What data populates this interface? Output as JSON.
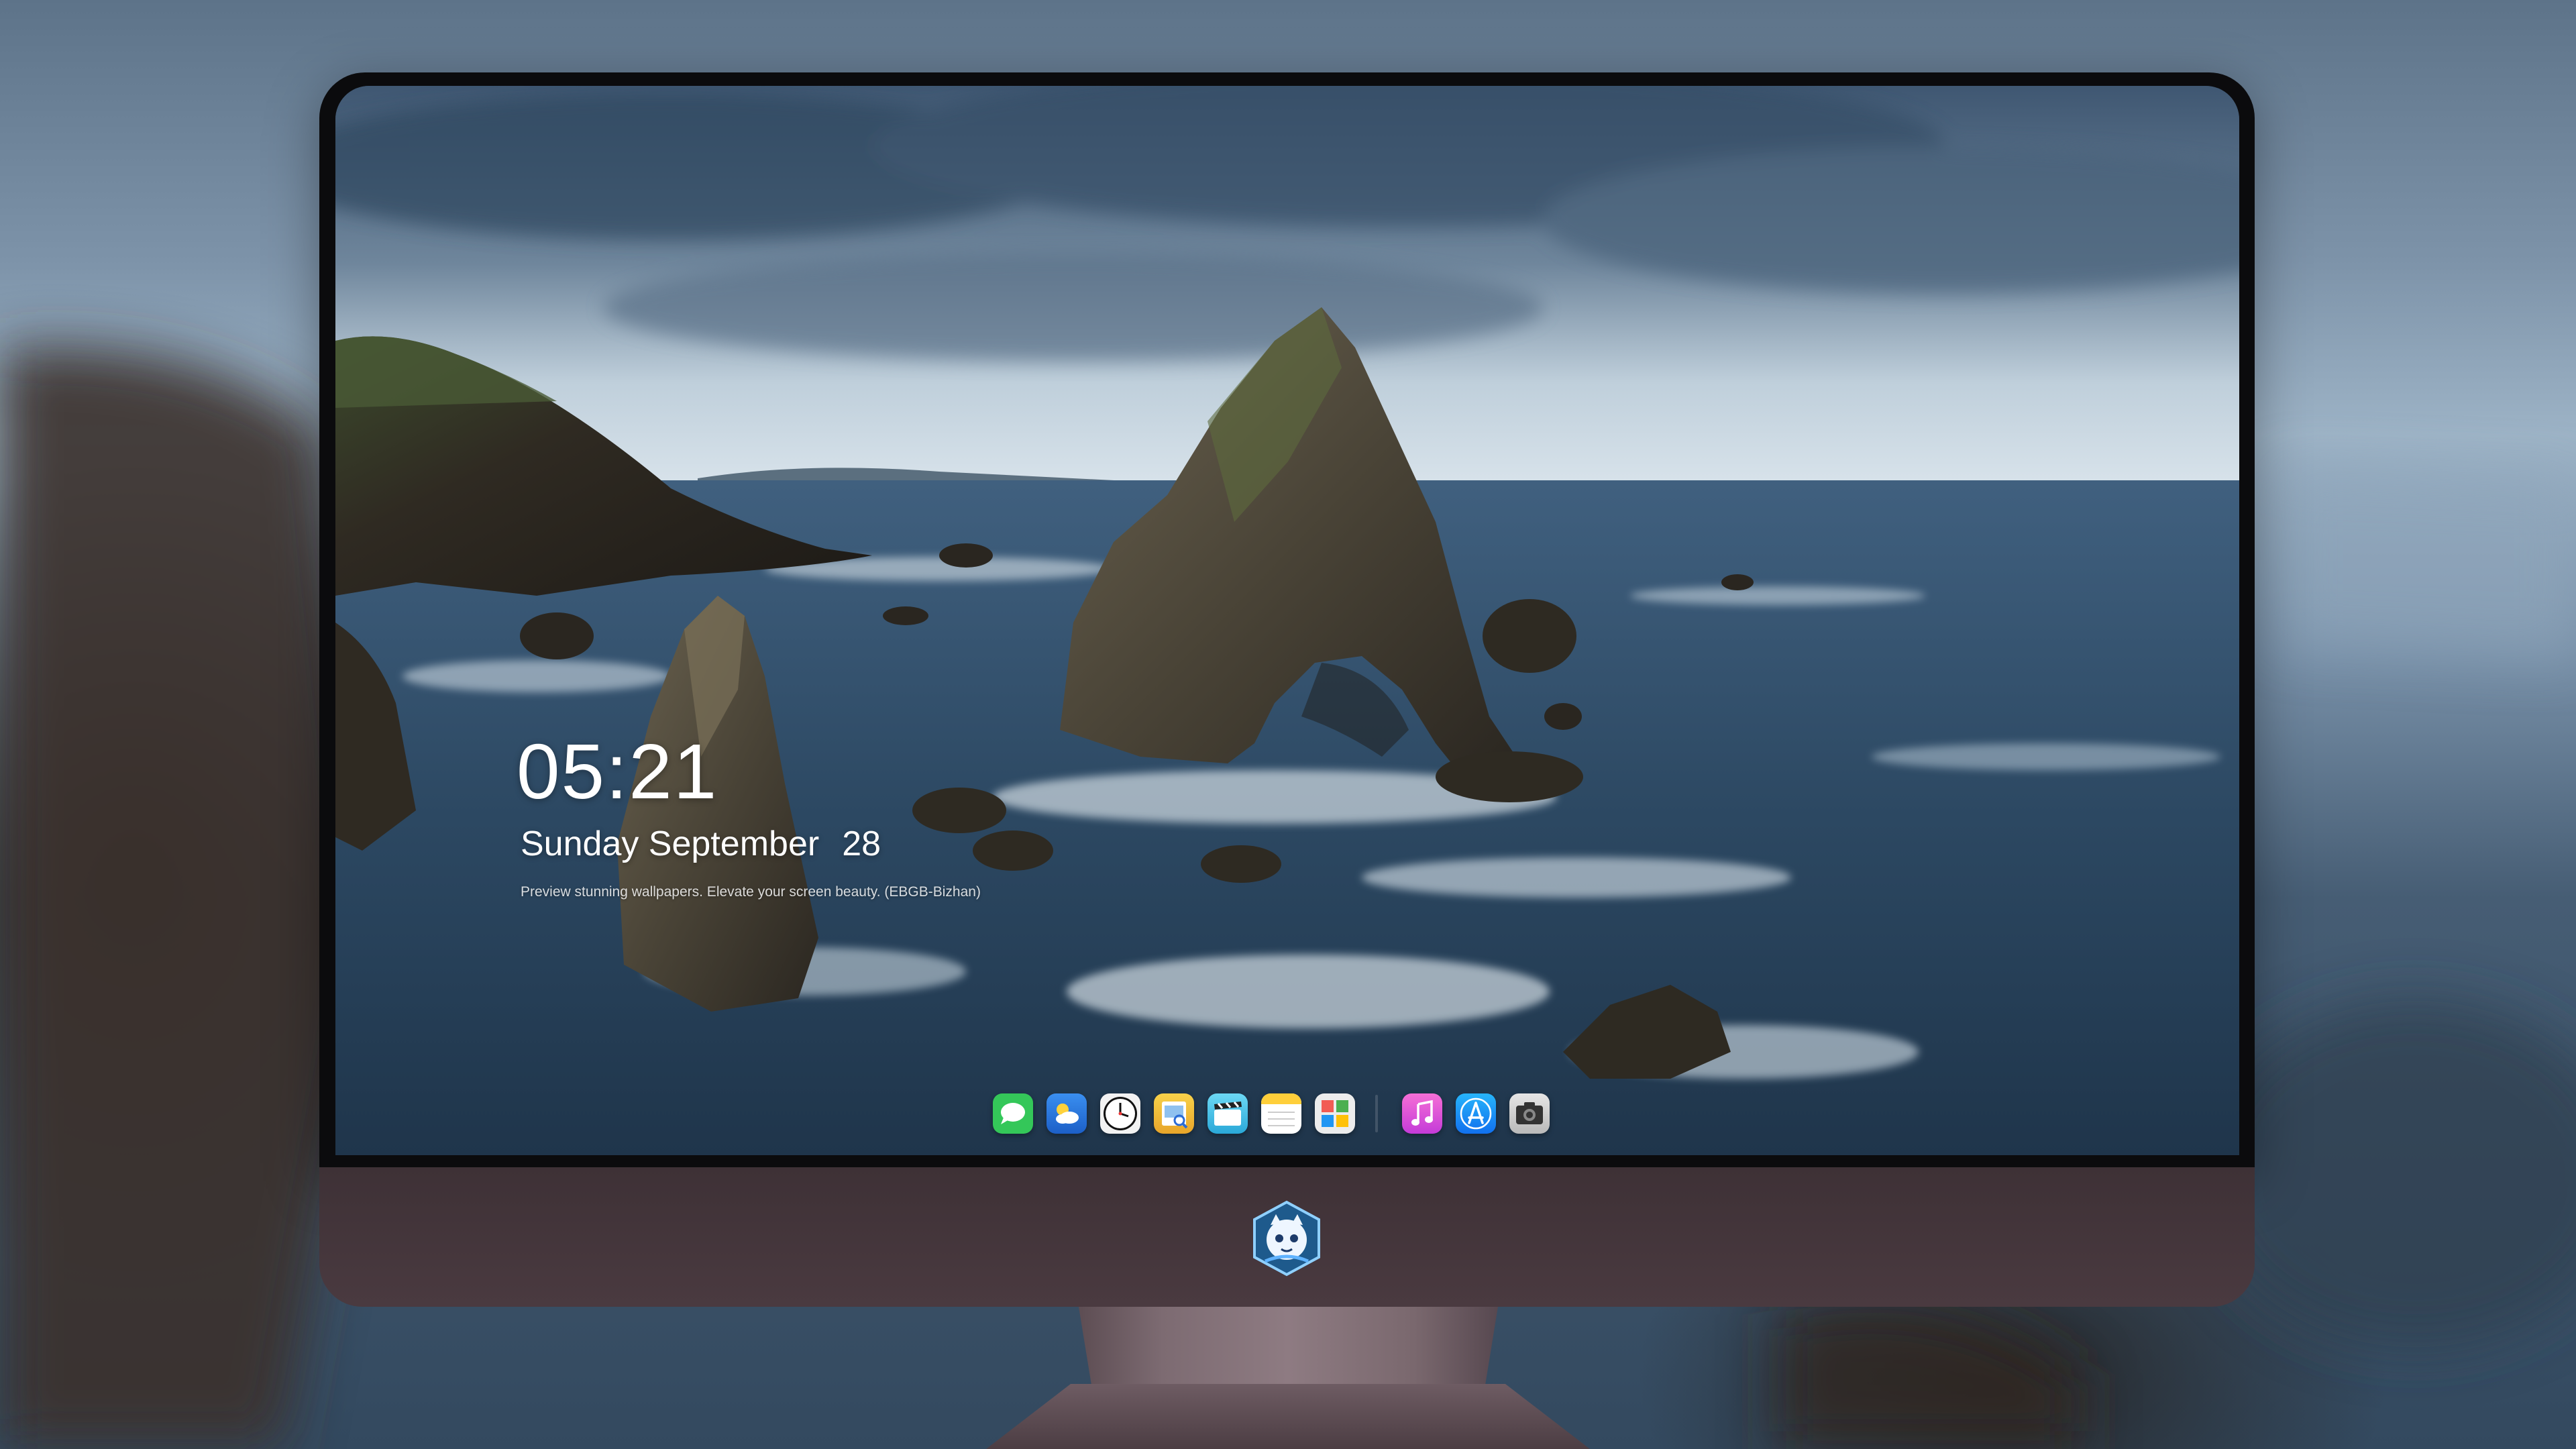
{
  "lock_screen": {
    "time": "05:21",
    "weekday_month": "Sunday September",
    "day": "28",
    "caption": "Preview stunning wallpapers. Elevate your screen beauty. (EBGB-Bizhan)"
  },
  "dock": {
    "apps": [
      {
        "name": "Messages",
        "icon": "messages-icon",
        "color": "#34c759"
      },
      {
        "name": "Weather",
        "icon": "weather-icon",
        "color": "#2f7fe0"
      },
      {
        "name": "Clock",
        "icon": "clock-icon",
        "color": "#ffffff"
      },
      {
        "name": "Preview",
        "icon": "preview-icon",
        "color": "#f4c542"
      },
      {
        "name": "Clips",
        "icon": "clips-icon",
        "color": "#55c8e8"
      },
      {
        "name": "Notes",
        "icon": "notes-icon",
        "color": "#ffd84a"
      },
      {
        "name": "Photo Booth",
        "icon": "photo-grid-icon",
        "color": "#e9e9e9"
      },
      {
        "name": "Music",
        "icon": "music-icon",
        "color": "#e94dc7"
      },
      {
        "name": "App Store",
        "icon": "app-store-icon",
        "color": "#1f8ff5"
      },
      {
        "name": "Camera",
        "icon": "camera-icon",
        "color": "#d8d8d8"
      }
    ]
  },
  "monitor": {
    "logo": "mascot-logo-icon",
    "colors": {
      "bezel": "#0b0b0d",
      "chin": "#45363c",
      "stand": "#7d6b72"
    }
  }
}
